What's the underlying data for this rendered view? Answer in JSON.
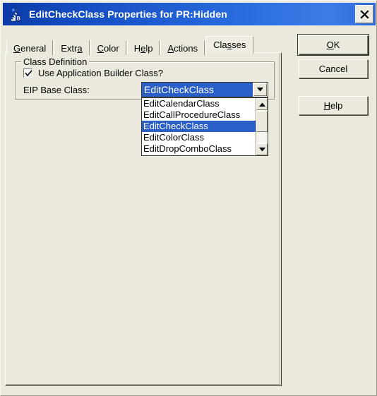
{
  "window": {
    "title": "EditCheckClass Properties for PR:Hidden",
    "icon_name": "app-builder-icon",
    "close_label": "✕"
  },
  "tabs": [
    {
      "pre": "",
      "accel": "G",
      "post": "eneral",
      "active": false,
      "name": "tab-general"
    },
    {
      "pre": "Extr",
      "accel": "a",
      "post": "",
      "active": false,
      "name": "tab-extra"
    },
    {
      "pre": "",
      "accel": "C",
      "post": "olor",
      "active": false,
      "name": "tab-color"
    },
    {
      "pre": "H",
      "accel": "e",
      "post": "lp",
      "active": false,
      "name": "tab-help"
    },
    {
      "pre": "",
      "accel": "A",
      "post": "ctions",
      "active": false,
      "name": "tab-actions"
    },
    {
      "pre": "Cla",
      "accel": "s",
      "post": "ses",
      "active": true,
      "name": "tab-classes"
    }
  ],
  "group": {
    "legend": "Class Definition"
  },
  "checkbox": {
    "label": "Use Application Builder Class?",
    "checked": true
  },
  "eip": {
    "label": "EIP Base Class:",
    "selected_value": "EditCheckClass",
    "options": [
      "EditCalendarClass",
      "EditCallProcedureClass",
      "EditCheckClass",
      "EditColorClass",
      "EditDropComboClass"
    ],
    "highlighted_option": "EditCheckClass",
    "dropdown_open": true
  },
  "buttons": [
    {
      "pre": "",
      "accel": "O",
      "post": "K",
      "name": "ok-button",
      "default": true
    },
    {
      "pre": "Cancel",
      "accel": "",
      "post": "",
      "name": "cancel-button",
      "default": false
    },
    {
      "pre": "",
      "accel": "H",
      "post": "elp",
      "name": "help-button",
      "default": false
    }
  ],
  "colors": {
    "face": "#EBE9DD",
    "title_dark": "#0A3AA8",
    "title_light": "#3C7CE8",
    "selection": "#2A5FC8",
    "text": "#000000"
  },
  "icons": {
    "combo_arrow": "chevron-down-icon",
    "scroll_up": "scroll-up-icon",
    "scroll_down": "scroll-down-icon",
    "checkmark": "checkmark-icon",
    "close": "close-icon"
  }
}
